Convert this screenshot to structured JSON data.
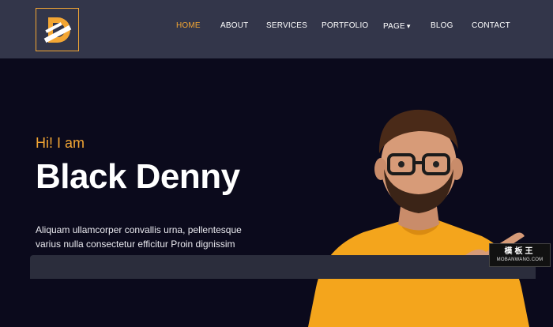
{
  "header": {
    "logo": {
      "letter": "D",
      "accent": "#f3a634"
    },
    "nav": [
      {
        "label": "HOME",
        "active": true
      },
      {
        "label": "ABOUT"
      },
      {
        "label": "SERVICES"
      },
      {
        "label": "PORTFOLIO"
      },
      {
        "label": "PAGE",
        "caret": "▾"
      },
      {
        "label": "BLOG"
      },
      {
        "label": "CONTACT"
      }
    ]
  },
  "hero": {
    "greeting": "Hi! I am",
    "name": "Black Denny",
    "description": "Aliquam ullamcorper convallis urna, pellentesque varius nulla consectetur efficitur Proin dignissim consectetur."
  },
  "watermark": {
    "title": "模板王",
    "subtitle": "MOBANWANG.COM"
  },
  "colors": {
    "header_bg": "#33364a",
    "hero_bg": "#0b0a1c",
    "accent": "#f3a634",
    "shirt": "#f4a51c"
  }
}
